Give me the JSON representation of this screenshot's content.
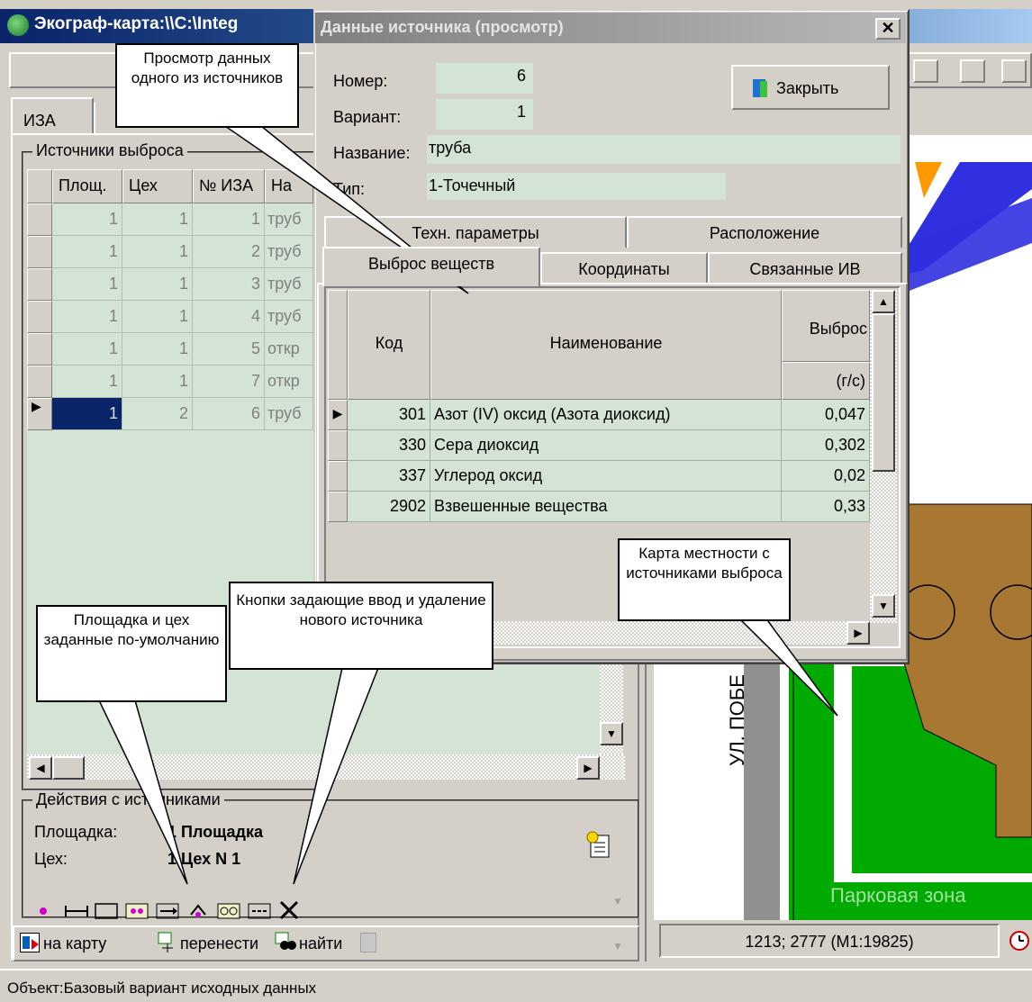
{
  "main_window": {
    "title": "Экограф-карта:\\\\C:\\Integ"
  },
  "left_panel": {
    "tab_label": "ИЗА",
    "group_label": "Источники выброса",
    "columns": [
      "Площ.",
      "Цех",
      "№ ИЗА",
      "На"
    ],
    "rows": [
      {
        "plosh": "1",
        "tseh": "1",
        "nomer": "1",
        "name": "труб"
      },
      {
        "plosh": "1",
        "tseh": "1",
        "nomer": "2",
        "name": "труб"
      },
      {
        "plosh": "1",
        "tseh": "1",
        "nomer": "3",
        "name": "труб"
      },
      {
        "plosh": "1",
        "tseh": "1",
        "nomer": "4",
        "name": "труб"
      },
      {
        "plosh": "1",
        "tseh": "1",
        "nomer": "5",
        "name": "откр"
      },
      {
        "plosh": "1",
        "tseh": "1",
        "nomer": "7",
        "name": "откр"
      },
      {
        "plosh": "1",
        "tseh": "2",
        "nomer": "6",
        "name": "труб"
      }
    ],
    "actions_group_label": "Действия с источниками",
    "ploshadka_label": "Площадка:",
    "ploshadka_value": "1 Площадка",
    "tseh_label": "Цех:",
    "tseh_value": "1 Цех N 1",
    "bottom_tabs": [
      "на карту",
      "перенести",
      "найти"
    ]
  },
  "dialog": {
    "title": "Данные источника (просмотр)",
    "close_button": "Закрыть",
    "labels": {
      "nomer": "Номер:",
      "variant": "Вариант:",
      "name": "Название:",
      "type": "Тип:"
    },
    "values": {
      "nomer": "6",
      "variant": "1",
      "name": "труба",
      "type": "1-Точечный"
    },
    "tabs_row1": [
      "Техн. параметры",
      "Расположение"
    ],
    "tabs_row2": [
      "Выброс веществ",
      "Координаты",
      "Связанные ИВ"
    ],
    "grid_headers": {
      "kod": "Код",
      "name": "Наименование",
      "vybros": "Выброс",
      "unit": "(г/с)"
    },
    "grid_rows": [
      {
        "kod": "301",
        "name": "Азот (IV) оксид (Азота диоксид)",
        "value": "0,047"
      },
      {
        "kod": "330",
        "name": "Сера диоксид",
        "value": "0,302"
      },
      {
        "kod": "337",
        "name": "Углерод оксид",
        "value": "0,02"
      },
      {
        "kod": "2902",
        "name": "Взвешенные вещества",
        "value": "0,33"
      }
    ]
  },
  "map": {
    "street_label": "УЛ. ПОБЕ",
    "zone_label": "Парковая зона",
    "coordinates": "1213; 2777 (M1:19825)"
  },
  "callouts": {
    "view": "Просмотр данных одного из источников",
    "map": "Карта местности с источниками выброса",
    "defaults": "Площадка и цех заданные по-умолчанию",
    "buttons": "Кнопки задающие ввод и удаление нового источника"
  },
  "statusbar": {
    "text": "Объект:Базовый вариант исходных данных"
  },
  "colors": {
    "row_bg": "#d4e4d4",
    "map_green": "#00aa00",
    "map_brown": "#a87832",
    "title_active": "#0a246a",
    "title_inactive": "#808080"
  }
}
